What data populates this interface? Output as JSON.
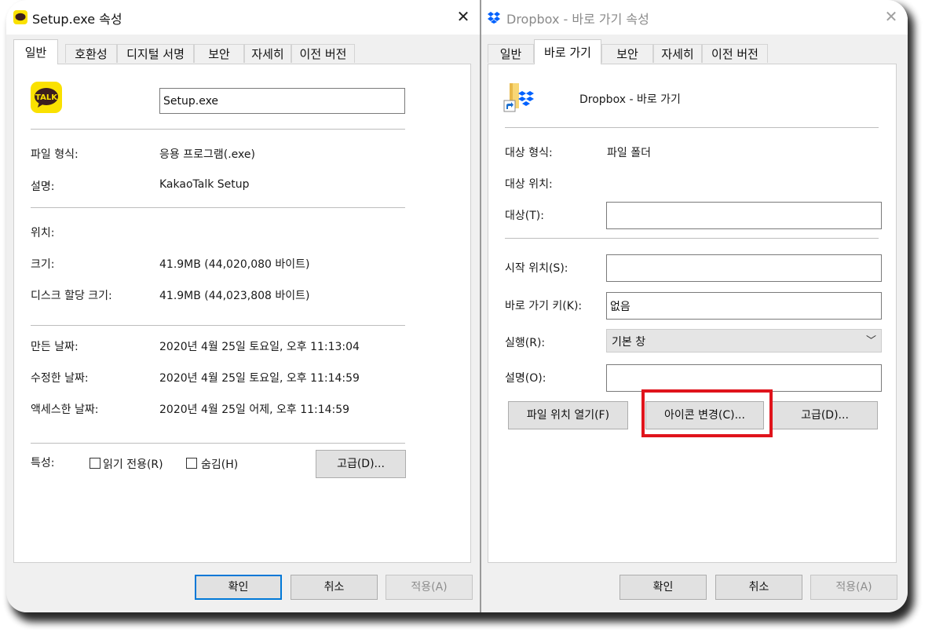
{
  "left_dialog": {
    "title": "Setup.exe 속성",
    "close": "✕",
    "tabs": [
      "일반",
      "호환성",
      "디지털 서명",
      "보안",
      "자세히",
      "이전 버전"
    ],
    "active_tab": "일반",
    "icon_text": "TALK",
    "file_name": "Setup.exe",
    "props": {
      "type_label": "파일 형식:",
      "type_value": "응용 프로그램(.exe)",
      "desc_label": "설명:",
      "desc_value": "KakaoTalk Setup",
      "location_label": "위치:",
      "location_value": "",
      "size_label": "크기:",
      "size_value": "41.9MB (44,020,080 바이트)",
      "disk_label": "디스크 할당 크기:",
      "disk_value": "41.9MB (44,023,808 바이트)",
      "created_label": "만든 날짜:",
      "created_value": "2020년 4월 25일 토요일, 오후 11:13:04",
      "modified_label": "수정한 날짜:",
      "modified_value": "2020년 4월 25일 토요일, 오후 11:14:59",
      "accessed_label": "액세스한 날짜:",
      "accessed_value": "2020년 4월 25일 어제, 오후 11:14:59"
    },
    "attributes": {
      "label": "특성:",
      "readonly": "읽기 전용(R)",
      "hidden": "숨김(H)",
      "advanced": "고급(D)..."
    },
    "buttons": {
      "ok": "확인",
      "cancel": "취소",
      "apply": "적용(A)"
    }
  },
  "right_dialog": {
    "title": "Dropbox - 바로 가기 속성",
    "close": "✕",
    "tabs": [
      "일반",
      "바로 가기",
      "보안",
      "자세히",
      "이전 버전"
    ],
    "active_tab": "바로 가기",
    "shortcut_name": "Dropbox - 바로 가기",
    "props": {
      "target_type_label": "대상 형식:",
      "target_type_value": "파일 폴더",
      "target_location_label": "대상 위치:",
      "target_location_value": "",
      "target_label": "대상(T):",
      "target_value": "",
      "start_in_label": "시작 위치(S):",
      "start_in_value": "",
      "hotkey_label": "바로 가기 키(K):",
      "hotkey_value": "없음",
      "run_label": "실행(R):",
      "run_value": "기본 창",
      "comment_label": "설명(O):",
      "comment_value": ""
    },
    "action_buttons": {
      "open_location": "파일 위치 열기(F)",
      "change_icon": "아이콘 변경(C)...",
      "advanced": "고급(D)..."
    },
    "buttons": {
      "ok": "확인",
      "cancel": "취소",
      "apply": "적용(A)"
    }
  },
  "colors": {
    "highlight": "#e0141c",
    "accent": "#0078d7",
    "kakao_yellow": "#fae100",
    "dropbox_blue": "#0061fe"
  }
}
